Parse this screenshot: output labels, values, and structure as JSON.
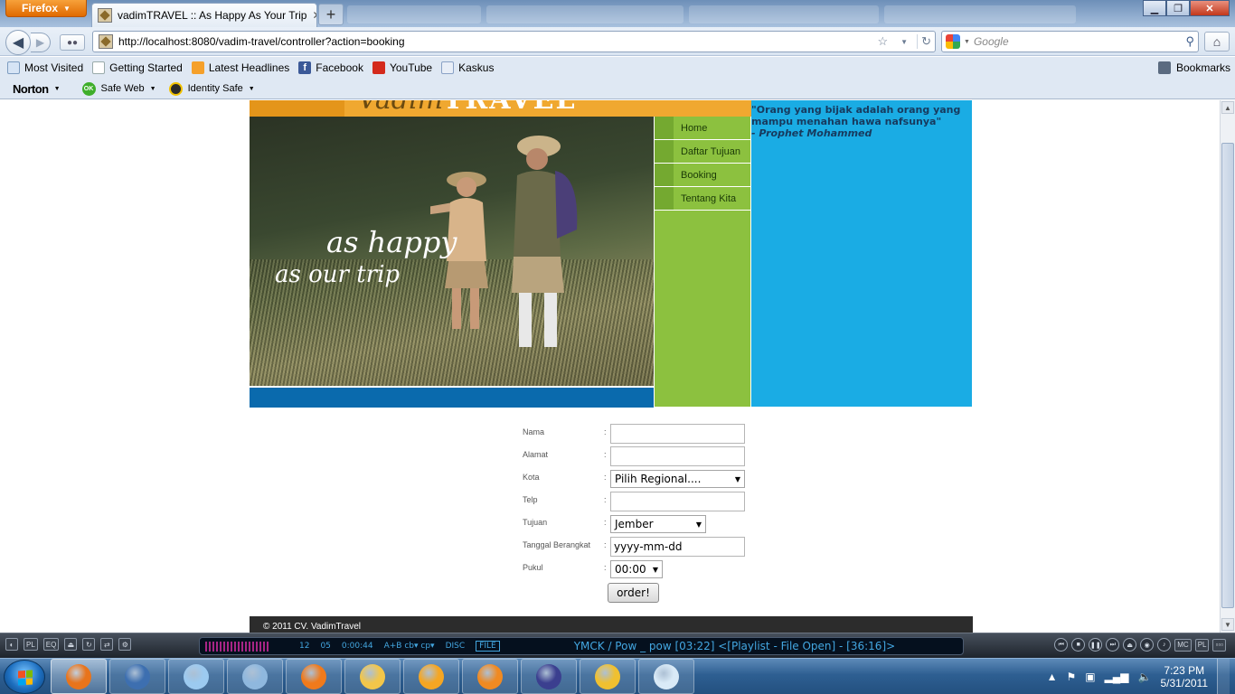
{
  "browser": {
    "app_button": "Firefox",
    "active_tab_title": "vadimTRAVEL :: As Happy As Your Trip",
    "new_tab_symbol": "+",
    "url": "http://localhost:8080/vadim-travel/controller?action=booking",
    "search_placeholder": "Google",
    "bookmarks": [
      {
        "label": "Most Visited",
        "icon": "star-page-icon"
      },
      {
        "label": "Getting Started",
        "icon": "page-icon"
      },
      {
        "label": "Latest Headlines",
        "icon": "rss-icon"
      },
      {
        "label": "Facebook",
        "icon": "facebook-icon"
      },
      {
        "label": "YouTube",
        "icon": "youtube-icon"
      },
      {
        "label": "Kaskus",
        "icon": "kaskus-icon"
      }
    ],
    "bookmarks_menu": "Bookmarks",
    "norton": {
      "logo": "Norton",
      "safe_web": "Safe Web",
      "safe_web_badge": "OK",
      "identity_safe": "Identity Safe"
    }
  },
  "site": {
    "logo_text": "Vadim",
    "logo_text_bold": "TRAVEL",
    "hero_tagline_1": "as happy",
    "hero_tagline_2": "as our trip",
    "nav": [
      "Home",
      "Daftar Tujuan",
      "Booking",
      "Tentang Kita"
    ],
    "quote": "\"Orang yang bijak adalah orang yang mampu menahan hawa nafsunya\"",
    "quote_author": "- Prophet Mohammed",
    "footer": "© 2011 CV. VadimTravel",
    "colors": {
      "orange": "#f0a830",
      "green": "#8cc13f",
      "blue_panel": "#1aace4",
      "hero_bar": "#0a6aad",
      "footer": "#2c2c2c"
    }
  },
  "form": {
    "fields": {
      "nama": {
        "label": "Nama",
        "value": ""
      },
      "alamat": {
        "label": "Alamat",
        "value": ""
      },
      "kota": {
        "label": "Kota",
        "selected": "Pilih Regional...."
      },
      "telp": {
        "label": "Telp",
        "value": ""
      },
      "tujuan": {
        "label": "Tujuan",
        "selected": "Jember"
      },
      "tanggal": {
        "label": "Tanggal Berangkat",
        "value": "yyyy-mm-dd"
      },
      "pukul": {
        "label": "Pukul",
        "selected": "00:00"
      }
    },
    "colon": ":",
    "submit_label": "order!"
  },
  "player": {
    "track_number": "12",
    "channel": "05",
    "elapsed": "0:00:44",
    "modes": "A+B  cb▾ cp▾",
    "disc": "DISC",
    "file": "FILE",
    "track_title": "YMCK / Pow _ pow  [03:22]    <[Playlist - File Open] - [36:16]>"
  },
  "taskbar": {
    "apps": [
      {
        "name": "firefox",
        "color": "#e8741c",
        "active": true
      },
      {
        "name": "thunderbird",
        "color": "#3d6fb0",
        "active": false
      },
      {
        "name": "virtualbox",
        "color": "#9ccaf0",
        "active": false
      },
      {
        "name": "remote-desktop",
        "color": "#8fb8de",
        "active": false
      },
      {
        "name": "xampp",
        "color": "#f07a1c",
        "active": false
      },
      {
        "name": "explorer",
        "color": "#f2c64a",
        "active": false
      },
      {
        "name": "netbeans",
        "color": "#f5a623",
        "active": false
      },
      {
        "name": "media-player",
        "color": "#f08a22",
        "active": false
      },
      {
        "name": "eclipse",
        "color": "#3b3f8f",
        "active": false
      },
      {
        "name": "globe",
        "color": "#f0c030",
        "active": false
      },
      {
        "name": "paint",
        "color": "#d9eaf7",
        "active": false
      }
    ],
    "time": "7:23 PM",
    "date": "5/31/2011"
  }
}
